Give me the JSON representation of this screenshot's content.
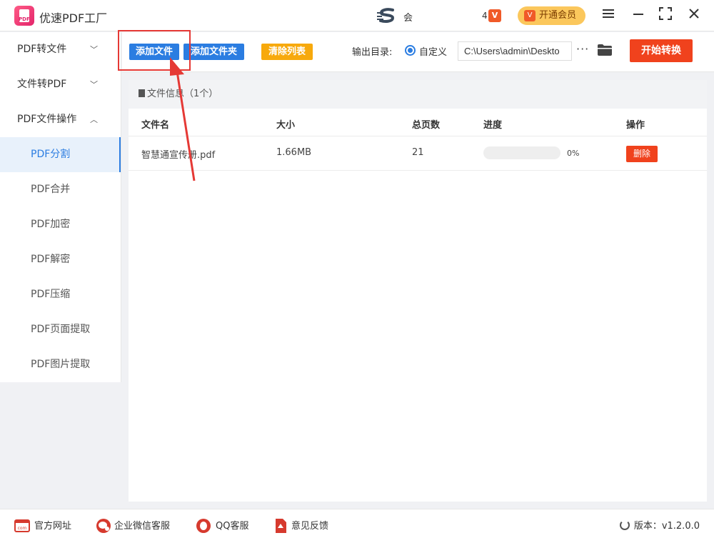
{
  "app": {
    "title": "优速PDF工厂",
    "logo_tag": "PDF",
    "ts_text": "会",
    "notif_count": "4",
    "notif_icon": "V",
    "vip_label": "开通会员",
    "vip_icon": "V"
  },
  "window_controls": [
    "menu-icon",
    "minimize-icon",
    "maximize-icon",
    "close-icon"
  ],
  "sidebar": {
    "groups": [
      {
        "label": "PDF转文件",
        "chevron": "﹀"
      },
      {
        "label": "文件转PDF",
        "chevron": "﹀"
      },
      {
        "label": "PDF文件操作",
        "chevron": "︿"
      }
    ],
    "items": [
      "PDF分割",
      "PDF合并",
      "PDF加密",
      "PDF解密",
      "PDF压缩",
      "PDF页面提取",
      "PDF图片提取"
    ],
    "active_item": "PDF分割"
  },
  "toolbar": {
    "add_file": "添加文件",
    "add_folder": "添加文件夹",
    "clear_list": "清除列表",
    "output_label": "输出目录:",
    "custom_label": "自定义",
    "output_path": "C:\\Users\\admin\\Deskto",
    "more": "···",
    "start": "开始转换"
  },
  "file_panel": {
    "header": "文件信息（1个）",
    "columns": [
      "文件名",
      "大小",
      "总页数",
      "进度",
      "操作"
    ],
    "rows": [
      {
        "name": "智慧通宣传册.pdf",
        "size": "1.66MB",
        "pages": "21",
        "progress": 0,
        "progress_text": "0%",
        "action": "删除"
      }
    ]
  },
  "bottom": {
    "links": [
      "官方网址",
      "企业微信客服",
      "QQ客服",
      "意见反馈"
    ],
    "version": "版本：v1.2.0.0"
  },
  "colors": {
    "accent_blue": "#2b7de1",
    "danger_red": "#f0421d",
    "clear_orange": "#f7a90c",
    "vip_gold": "#fbc75c"
  }
}
